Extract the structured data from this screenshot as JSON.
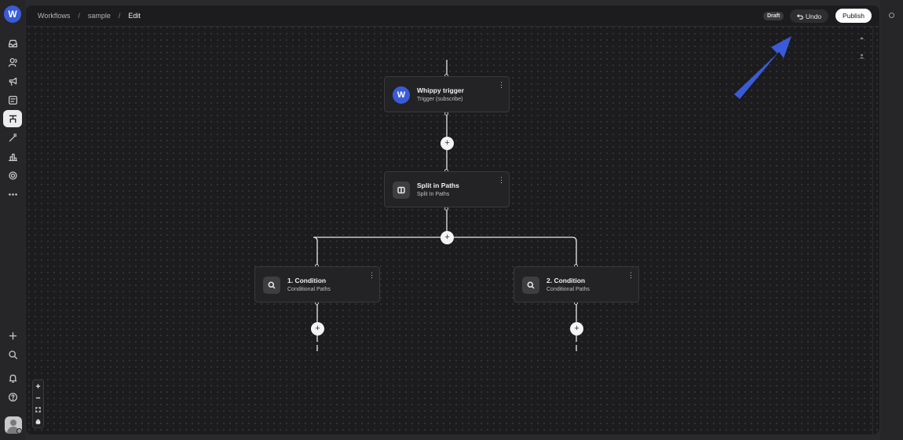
{
  "breadcrumb": {
    "items": [
      "Workflows",
      "sample",
      "Edit"
    ]
  },
  "header": {
    "status": "Draft",
    "undo_label": "Undo",
    "publish_label": "Publish"
  },
  "brand_letter": "W",
  "nodes": {
    "trigger": {
      "title": "Whippy trigger",
      "subtitle": "Trigger (subscribe)",
      "icon": "whippy-logo-icon"
    },
    "split": {
      "title": "Split in Paths",
      "subtitle": "Split In Paths",
      "icon": "split-icon"
    },
    "cond1": {
      "title": "1. Condition",
      "subtitle": "Conditional Paths",
      "icon": "search-icon"
    },
    "cond2": {
      "title": "2. Condition",
      "subtitle": "Conditional Paths",
      "icon": "search-icon"
    }
  },
  "plus_glyph": "+",
  "menu_glyph": "⋮",
  "colors": {
    "accent": "#3a5bd9",
    "canvas": "#1c1c1e",
    "arrow": "#3a5bd9"
  }
}
